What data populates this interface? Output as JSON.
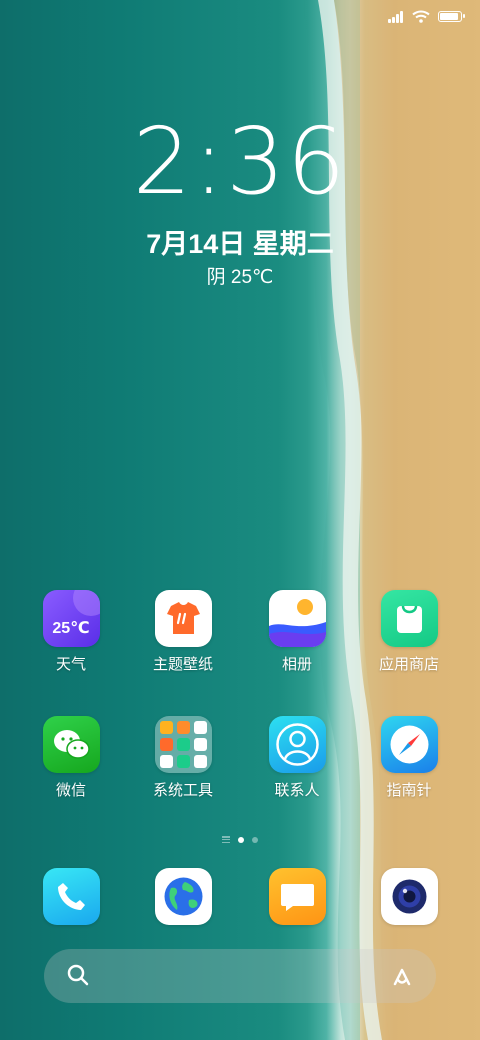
{
  "status_bar": {
    "signal_icon": "cell-signal-icon",
    "wifi_icon": "wifi-icon",
    "battery_icon": "battery-icon",
    "battery_level": 1.0
  },
  "lockscreen": {
    "time": "2:36",
    "date": "7月14日 星期二",
    "weather": "阴 25℃"
  },
  "apps_row1": [
    {
      "label": "天气",
      "icon": "weather-icon",
      "badge": "25℃"
    },
    {
      "label": "主题壁纸",
      "icon": "theme-tshirt-icon"
    },
    {
      "label": "相册",
      "icon": "gallery-icon"
    },
    {
      "label": "应用商店",
      "icon": "app-store-bag-icon"
    }
  ],
  "apps_row2": [
    {
      "label": "微信",
      "icon": "wechat-icon"
    },
    {
      "label": "系统工具",
      "icon": "folder-icon"
    },
    {
      "label": "联系人",
      "icon": "contacts-icon"
    },
    {
      "label": "指南针",
      "icon": "compass-icon"
    }
  ],
  "dock": [
    {
      "icon": "phone-icon"
    },
    {
      "icon": "browser-globe-icon"
    },
    {
      "icon": "messages-icon"
    },
    {
      "icon": "camera-icon"
    }
  ],
  "page_indicator": {
    "pages": 2,
    "current": 1
  },
  "search": {
    "left_icon": "search-icon",
    "right_icon": "assistant-icon"
  },
  "colors": {
    "sea": "#0f7b74",
    "sand": "#e2b874",
    "weather_purple": "#6a3df0",
    "theme_orange": "#ff6a2b",
    "store_green": "#1fd48f",
    "wechat_green": "#1aad19",
    "compass_blue": "#1a9bea",
    "message_orange": "#ffa414"
  }
}
